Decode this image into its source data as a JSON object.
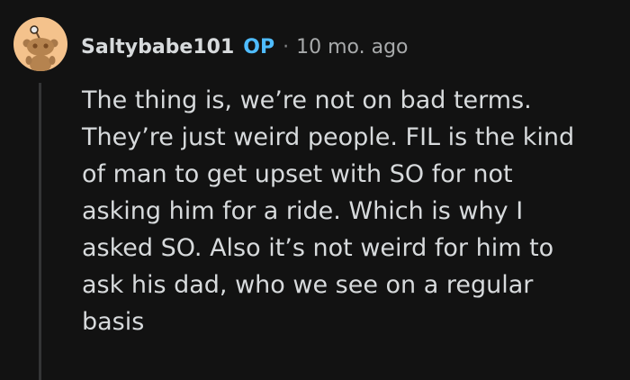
{
  "comment": {
    "username": "Saltybabe101",
    "op_badge": "OP",
    "separator": "·",
    "timestamp": "10 mo. ago",
    "avatar_icon": "snoo-avatar-icon",
    "body": "The thing is, we’re not on bad terms.\nThey’re just weird people. FIL is the kind\nof man to get upset with SO for not\nasking him for a ride. Which is why I\nasked SO. Also it’s not weird for him to\nask his dad, who we see on a regular\nbasis"
  },
  "colors": {
    "background": "#121212",
    "text": "#d7dadc",
    "op_badge": "#4fbcff",
    "meta": "#818384",
    "avatar_bg": "#f4c28c",
    "thread_line": "#343536"
  }
}
